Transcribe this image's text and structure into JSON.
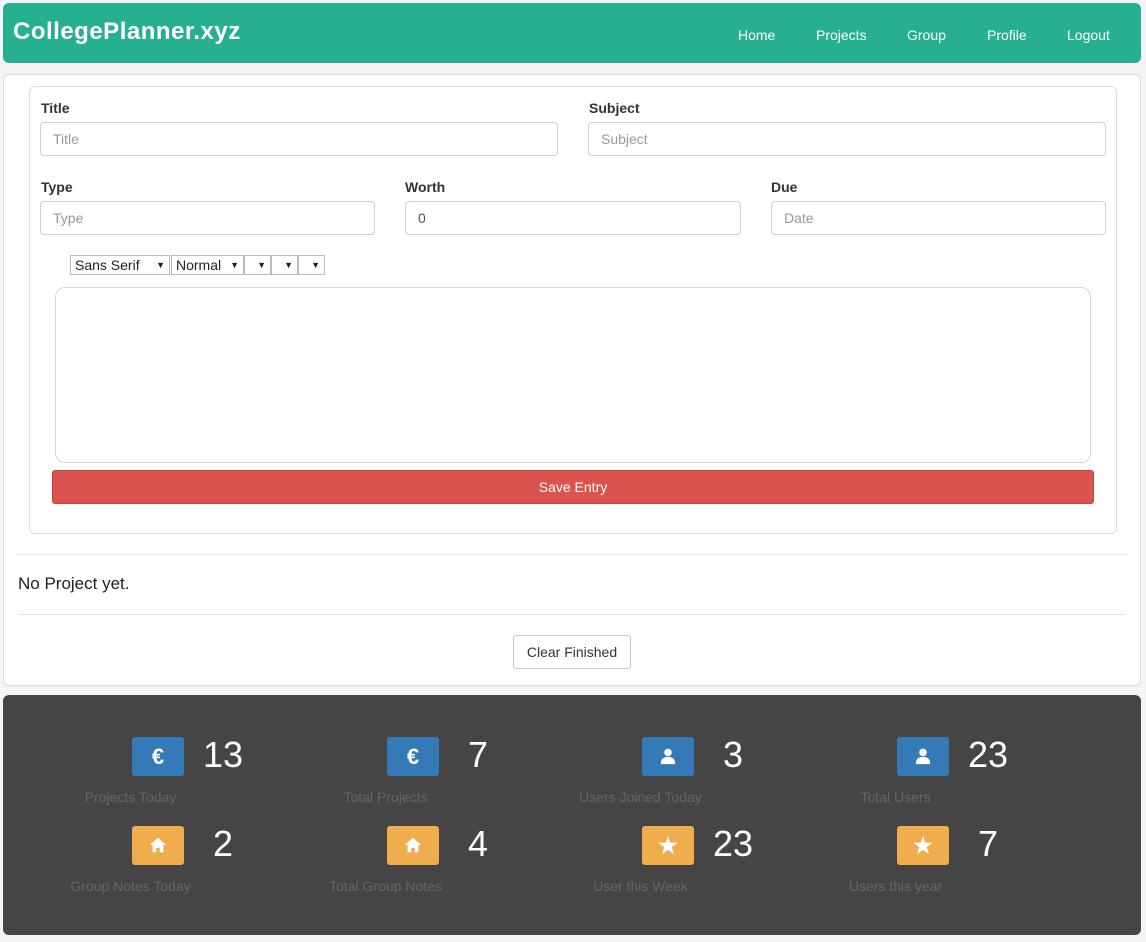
{
  "app": {
    "title": "CollegePlanner.xyz"
  },
  "nav": [
    "Home",
    "Projects",
    "Group",
    "Profile",
    "Logout"
  ],
  "form": {
    "title": {
      "label": "Title",
      "placeholder": "Title"
    },
    "subject": {
      "label": "Subject",
      "placeholder": "Subject"
    },
    "type": {
      "label": "Type",
      "placeholder": "Type"
    },
    "worth": {
      "label": "Worth",
      "value": "0"
    },
    "due": {
      "label": "Due",
      "placeholder": "Date"
    }
  },
  "toolbar": {
    "font_family": "Sans Serif",
    "font_size": "Normal",
    "arrow": "▼"
  },
  "buttons": {
    "save": "Save Entry",
    "clear_finished": "Clear Finished"
  },
  "status": {
    "no_project": "No Project yet."
  },
  "stats": [
    {
      "value": "13",
      "label": "Projects Today",
      "icon": "euro-icon",
      "color": "#337ab7"
    },
    {
      "value": "7",
      "label": "Total Projects",
      "icon": "euro-icon",
      "color": "#337ab7"
    },
    {
      "value": "3",
      "label": "Users Joined Today",
      "icon": "user-icon",
      "color": "#337ab7"
    },
    {
      "value": "23",
      "label": "Total Users",
      "icon": "user-icon",
      "color": "#337ab7"
    },
    {
      "value": "2",
      "label": "Group Notes Today",
      "icon": "home-icon",
      "color": "#f0ad4e"
    },
    {
      "value": "4",
      "label": "Total Group Notes",
      "icon": "home-icon",
      "color": "#f0ad4e"
    },
    {
      "value": "23",
      "label": "User this Week",
      "icon": "star-icon",
      "color": "#f0ad4e"
    },
    {
      "value": "7",
      "label": "Users this year",
      "icon": "star-icon",
      "color": "#f0ad4e"
    }
  ],
  "colors": {
    "navbar": "#26b090",
    "save": "#d9534f",
    "stats_bg": "#454545"
  }
}
